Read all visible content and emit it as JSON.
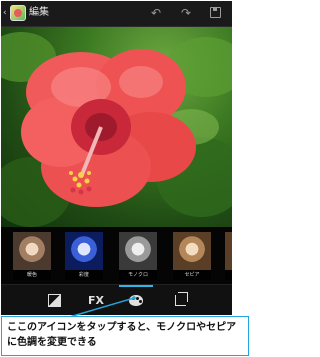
{
  "action_bar": {
    "title": "編集",
    "back_icon": "chevron-left-icon",
    "app_icon": "gallery-icon",
    "undo_icon": "undo-icon",
    "redo_icon": "redo-icon",
    "save_icon": "save-icon"
  },
  "filters": [
    {
      "label": "暖色"
    },
    {
      "label": "彩度"
    },
    {
      "label": "モノクロ"
    },
    {
      "label": "セピア"
    },
    {
      "label": "ネ"
    }
  ],
  "bottom_bar": {
    "exposure_icon": "exposure-icon",
    "fx_label": "FX",
    "color_icon": "palette-icon",
    "crop_icon": "crop-icon",
    "accent_color": "#2fb7e8"
  },
  "caption": {
    "text": "ここのアイコンをタップすると、モノクロやセピアに色調を変更できる"
  }
}
